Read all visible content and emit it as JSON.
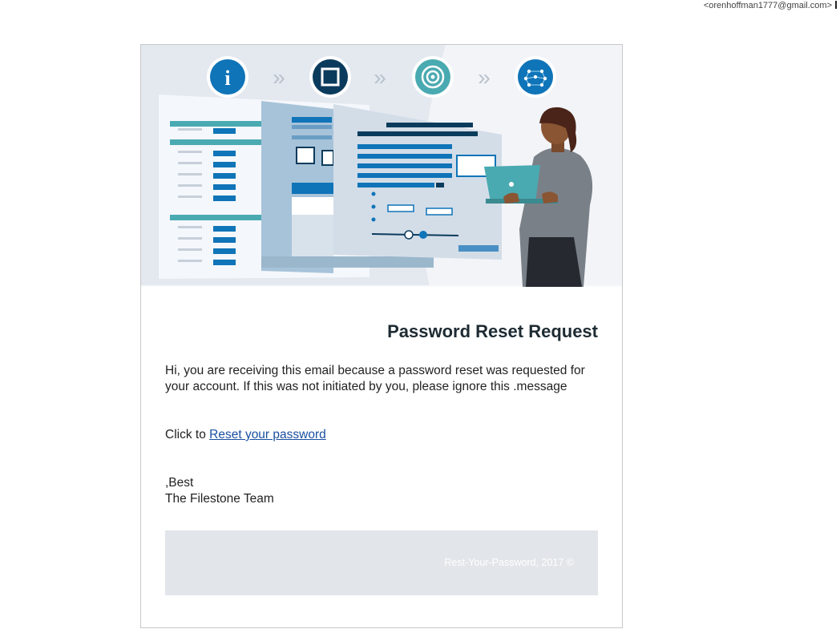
{
  "header": {
    "sender_email": "<orenhoffman1777@gmail.com>"
  },
  "hero": {
    "steps": [
      "info-icon",
      "square-icon",
      "target-icon",
      "network-icon"
    ],
    "separator_glyph": "»",
    "colors": {
      "accent_dark": "#0b3b5c",
      "accent_blue": "#0f74b8",
      "teal": "#4aaab1",
      "background": "#e4e8ef"
    }
  },
  "email": {
    "title": "Password Reset Request",
    "body": "Hi, you are receiving this email because a password reset was requested for your account. If this was not initiated by you, please ignore this .message",
    "click_prefix": "Click to",
    "link_text": "Reset your password",
    "signoff": ",Best",
    "team": "The Filestone Team",
    "footer": "Rest-Your-Password, 2017 ©"
  }
}
